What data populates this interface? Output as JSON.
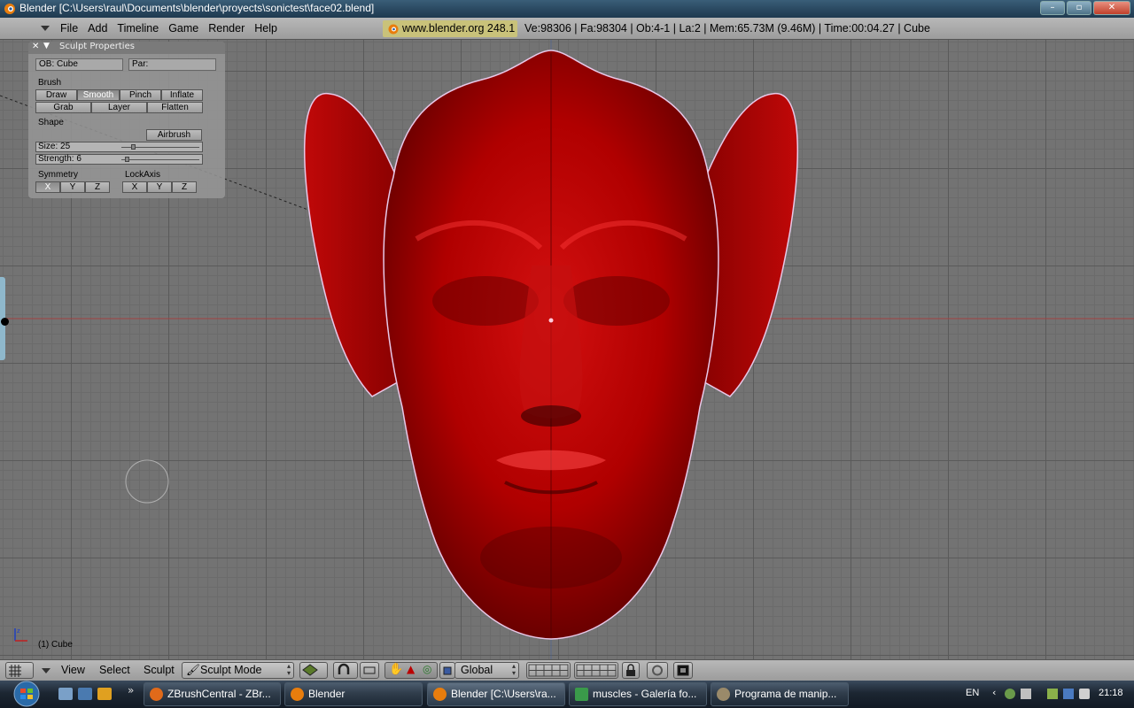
{
  "window": {
    "title": "Blender [C:\\Users\\raul\\Documents\\blender\\proyects\\sonictest\\face02.blend]",
    "controls": [
      "minimize",
      "maximize",
      "close"
    ]
  },
  "top_header": {
    "menus": [
      "File",
      "Add",
      "Timeline",
      "Game",
      "Render",
      "Help"
    ],
    "website": "www.blender.org 248.1",
    "stats": "Ve:98306 | Fa:98304 | Ob:4-1 | La:2  | Mem:65.73M (9.46M)  | Time:00:04.27 | Cube"
  },
  "sculpt_panel": {
    "title": "Sculpt Properties",
    "ob_field": "OB: Cube",
    "par_field": "Par:",
    "brush_label": "Brush",
    "brush_row1": [
      "Draw",
      "Smooth",
      "Pinch",
      "Inflate"
    ],
    "brush_row2": [
      "Grab",
      "Layer",
      "Flatten"
    ],
    "active_brush": "Smooth",
    "shape_label": "Shape",
    "airbrush": "Airbrush",
    "size_label": "Size: 25",
    "size_value": 25,
    "strength_label": "Strength: 6",
    "strength_value": 6,
    "symmetry_label": "Symmetry",
    "symmetry_buttons": [
      "X",
      "Y",
      "Z"
    ],
    "symmetry_active": "X",
    "lockaxis_label": "LockAxis",
    "lockaxis_buttons": [
      "X",
      "Y",
      "Z"
    ]
  },
  "viewport": {
    "object_label": "(1) Cube",
    "model_color": "#b00000"
  },
  "bottom_header": {
    "menus": [
      "View",
      "Select",
      "Sculpt"
    ],
    "mode": "Sculpt Mode",
    "orientation": "Global"
  },
  "taskbar": {
    "tasks": [
      {
        "label": "ZBrushCentral - ZBr...",
        "icon": "firefox-icon"
      },
      {
        "label": "Blender",
        "icon": "blender-icon"
      },
      {
        "label": "Blender [C:\\Users\\ra...",
        "icon": "blender-icon"
      },
      {
        "label": "muscles - Galería fo...",
        "icon": "photo-gallery-icon"
      },
      {
        "label": "Programa de manip...",
        "icon": "gimp-icon"
      }
    ],
    "language": "EN",
    "clock": "21:18"
  }
}
